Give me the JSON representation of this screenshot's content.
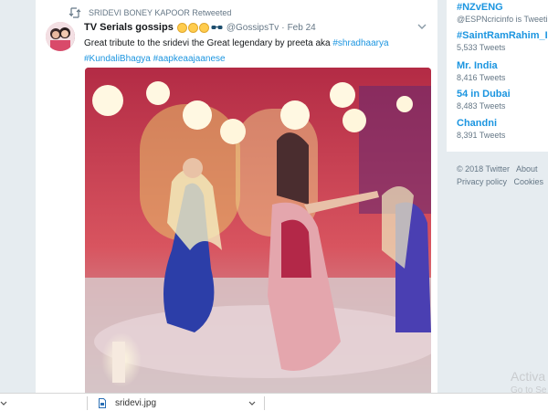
{
  "tweet": {
    "retweet_label": "SRIDEVI BONEY KAPOOR Retweeted",
    "author_name": "TV Serials gossips",
    "handle": "@GossipsTv",
    "dot": "·",
    "time": "Feb 24",
    "text_before": "Great tribute to the sridevi the Great legendary by preeta aka ",
    "hashtag_1": "#shradhaarya",
    "hashtag_2": "#KundaliBhagya",
    "hashtag_3": "#aapkeaajaanese",
    "icons": [
      "retweet-icon",
      "avatar",
      "emoji-icon",
      "sunglasses-icon",
      "caret-down-icon"
    ]
  },
  "sidebar": {
    "trends": [
      {
        "name": "#NZvENG",
        "meta": "@ESPNcricinfo is Tweetin"
      },
      {
        "name": "#SaintRamRahim_In",
        "meta": "5,533 Tweets"
      },
      {
        "name": "Mr. India",
        "meta": "8,416 Tweets"
      },
      {
        "name": "54 in Dubai",
        "meta": "8,483 Tweets"
      },
      {
        "name": "Chandni",
        "meta": "8,391 Tweets"
      }
    ],
    "footer": {
      "copyright": "© 2018 Twitter",
      "about": "About",
      "privacy": "Privacy policy",
      "cookies": "Cookies"
    }
  },
  "watermark": {
    "title": "Activa",
    "subtitle": "Go to Se"
  },
  "download_bar": {
    "item_2_name": "sridevi.jpg",
    "icons": [
      "file-icon",
      "chevron-down-icon"
    ]
  },
  "colors": {
    "link": "#1b95e0",
    "secondary_text": "#657786",
    "page_bg": "#e6ecf0"
  }
}
